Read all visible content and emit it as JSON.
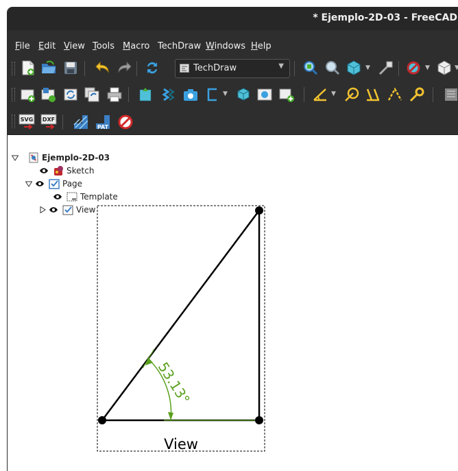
{
  "window": {
    "title": "* Ejemplo-2D-03 - FreeCAD"
  },
  "menu": [
    {
      "pre": "",
      "ul": "F",
      "post": "ile"
    },
    {
      "pre": "",
      "ul": "E",
      "post": "dit"
    },
    {
      "pre": "",
      "ul": "V",
      "post": "iew"
    },
    {
      "pre": "",
      "ul": "T",
      "post": "ools"
    },
    {
      "pre": "",
      "ul": "M",
      "post": "acro"
    },
    {
      "pre": "TechDraw",
      "ul": "",
      "post": ""
    },
    {
      "pre": "",
      "ul": "W",
      "post": "indows"
    },
    {
      "pre": "",
      "ul": "H",
      "post": "elp"
    }
  ],
  "workbench": {
    "label": "TechDraw"
  },
  "toolbar3": {
    "svg_label": "SVG",
    "dxf_label": "DXF",
    "pat_label": "PAT"
  },
  "tree": {
    "document": "Ejemplo-2D-03",
    "sketch": "Sketch",
    "page": "Page",
    "template": "Template",
    "view": "View"
  },
  "drawing": {
    "dimension_text": "53.13°",
    "view_label": "View",
    "dimension_color": "#5aa01e"
  }
}
